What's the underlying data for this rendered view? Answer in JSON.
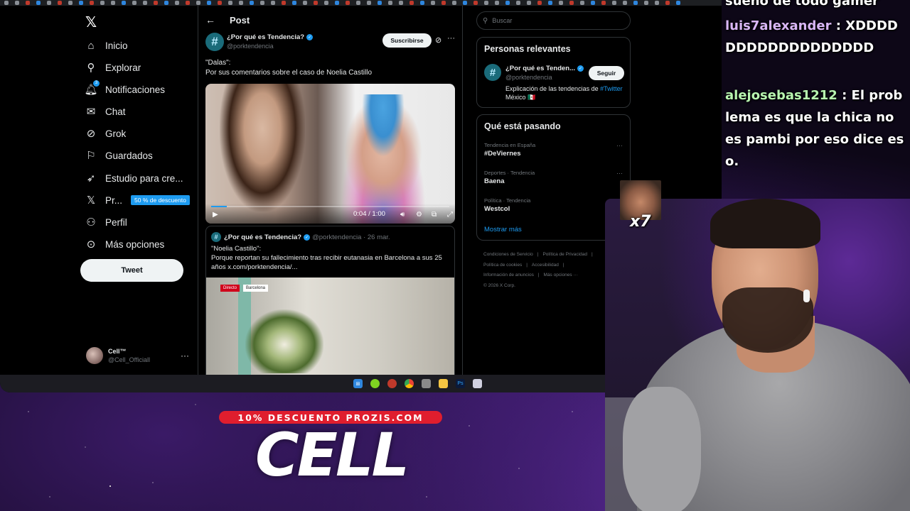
{
  "nav": {
    "items": [
      {
        "label": "Inicio",
        "icon": "home-icon"
      },
      {
        "label": "Explorar",
        "icon": "search-icon"
      },
      {
        "label": "Notificaciones",
        "icon": "bell-icon",
        "badge": "3"
      },
      {
        "label": "Chat",
        "icon": "mail-icon"
      },
      {
        "label": "Grok",
        "icon": "grok-icon"
      },
      {
        "label": "Guardados",
        "icon": "bookmark-icon"
      },
      {
        "label": "Estudio para cre...",
        "icon": "rocket-icon"
      },
      {
        "label": "Pr...",
        "icon": "x-premium-icon",
        "promo": "50 % de descuento"
      },
      {
        "label": "Perfil",
        "icon": "person-icon"
      },
      {
        "label": "Más opciones",
        "icon": "more-circle-icon"
      }
    ],
    "tweet_label": "Tweet",
    "account": {
      "name": "Cell™",
      "handle": "@Cell_Officiall"
    }
  },
  "post": {
    "header_title": "Post",
    "author_name": "¿Por qué es Tendencia?",
    "author_handle": "@porktendencia",
    "subscribe_label": "Suscribirse",
    "text_line1": "\"Dalas\":",
    "text_line2": "Por sus comentarios sobre el caso de Noelia Castillo",
    "video": {
      "time": "0:04 / 1:00",
      "progress": 0.067
    },
    "quote": {
      "author_name": "¿Por qué es Tendencia?",
      "meta": "@porktendencia · 26 mar.",
      "text_line1": "\"Noelia Castillo\":",
      "text_line2": "Porque reportan su fallecimiento tras recibir eutanasia en Barcelona a sus 25 años",
      "link": "x.com/porktendencia/...",
      "tag_live": "Directo",
      "tag_city": "Barcelona"
    }
  },
  "sidebar": {
    "search_placeholder": "Buscar",
    "relevant_title": "Personas relevantes",
    "relevant": {
      "name": "¿Por qué es Tenden...",
      "handle": "@porktendencia",
      "bio_prefix": "Explicación de las tendencias de",
      "bio_link": "#Twitter",
      "bio_suffix": "México 🇲🇽",
      "follow_label": "Seguir"
    },
    "trending_title": "Qué está pasando",
    "trends": [
      {
        "category": "Tendencia en España",
        "name": "#DeViernes"
      },
      {
        "category": "Deportes · Tendencia",
        "name": "Baena"
      },
      {
        "category": "Política · Tendencia",
        "name": "Westcol"
      }
    ],
    "show_more": "Mostrar más",
    "footer": [
      "Condiciones de Servicio",
      "|",
      "Política de Privacidad",
      "|",
      "Política de cookies",
      "|",
      "Accesibilidad",
      "|",
      "Información de anuncios",
      "|",
      "Más opciones ···",
      "© 2026 X Corp."
    ]
  },
  "overlay": {
    "promo": "10% DESCUENTO PROZIS.COM",
    "brand": "CELL",
    "emote_count": "x7"
  },
  "chat": [
    {
      "user": "",
      "text": "sueño de todo gamer"
    },
    {
      "user": "luis7alexander",
      "text": " : XDDDDDDDDDDDDDDDDDD"
    },
    {
      "user": "alejosebas1212",
      "text": " : El problema es que la chica no es pambi por eso dice eso."
    }
  ],
  "colors": {
    "accent": "#1d9bf0",
    "promo_red": "#e01e2e",
    "chat_user_green": "#b8f5b0"
  }
}
